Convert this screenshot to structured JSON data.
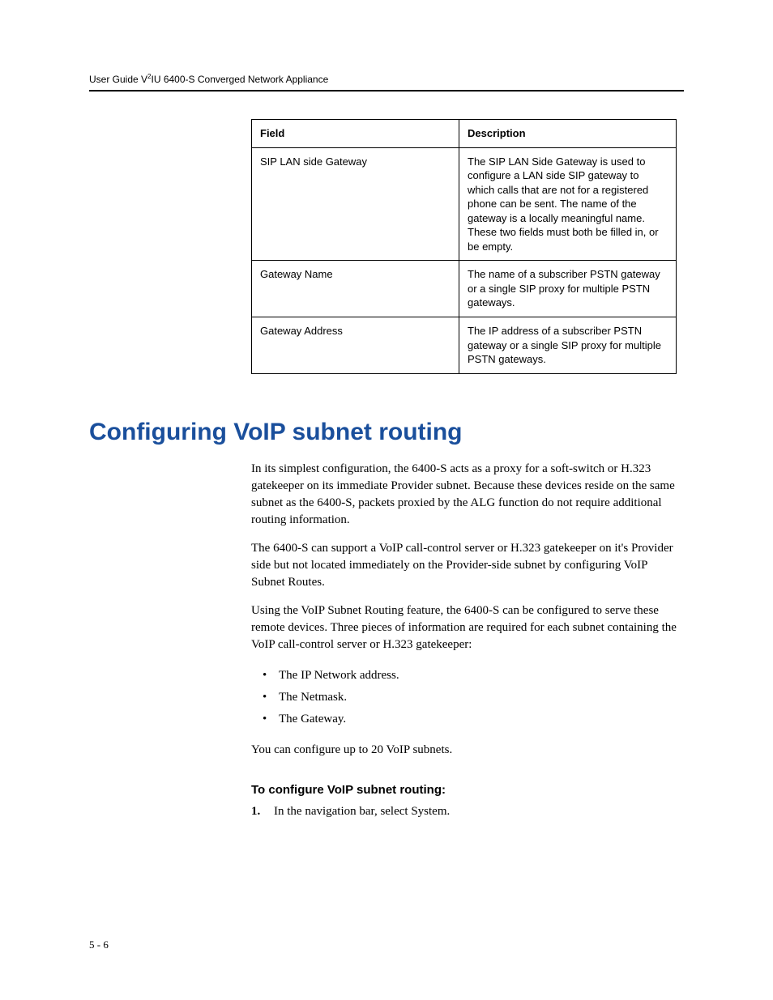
{
  "header": {
    "prefix": "User Guide V",
    "sup": "2",
    "suffix": "IU 6400-S Converged Network Appliance"
  },
  "table": {
    "head_field": "Field",
    "head_desc": "Description",
    "rows": [
      {
        "field": "SIP LAN side Gateway",
        "desc": "The SIP LAN Side Gateway is used to configure a LAN side SIP gateway to which calls that are not for a registered phone can be sent. The name of the gateway is a locally meaningful name. These two fields must both be filled in, or be empty."
      },
      {
        "field": "Gateway Name",
        "desc": "The name of a subscriber PSTN gateway or a single SIP proxy for multiple PSTN gateways."
      },
      {
        "field": "Gateway Address",
        "desc": "The IP address of a subscriber PSTN gateway or a single SIP proxy for multiple PSTN gateways."
      }
    ]
  },
  "section_title": "Configuring VoIP subnet routing",
  "paras": [
    "In its simplest configuration, the 6400-S acts as a proxy for a soft-switch or H.323 gatekeeper on its immediate Provider subnet. Because these devices reside on the same subnet as the 6400-S, packets proxied by the ALG function do not require additional routing information.",
    "The 6400-S can support a VoIP  call-control server or H.323 gatekeeper on it's Provider side but not located immediately on the Provider-side subnet by configuring VoIP Subnet Routes.",
    "Using the VoIP Subnet Routing feature, the 6400-S can be configured to serve these remote devices. Three pieces of information are required for each subnet containing the VoIP call-control server or H.323 gatekeeper:"
  ],
  "bullets": [
    "The IP Network address.",
    "The Netmask.",
    "The Gateway."
  ],
  "after_bullets": "You can configure up to 20 VoIP subnets.",
  "task_heading": "To configure VoIP subnet routing:",
  "steps": [
    {
      "n": "1.",
      "text": "In the navigation bar, select System."
    }
  ],
  "page_number": "5 - 6"
}
